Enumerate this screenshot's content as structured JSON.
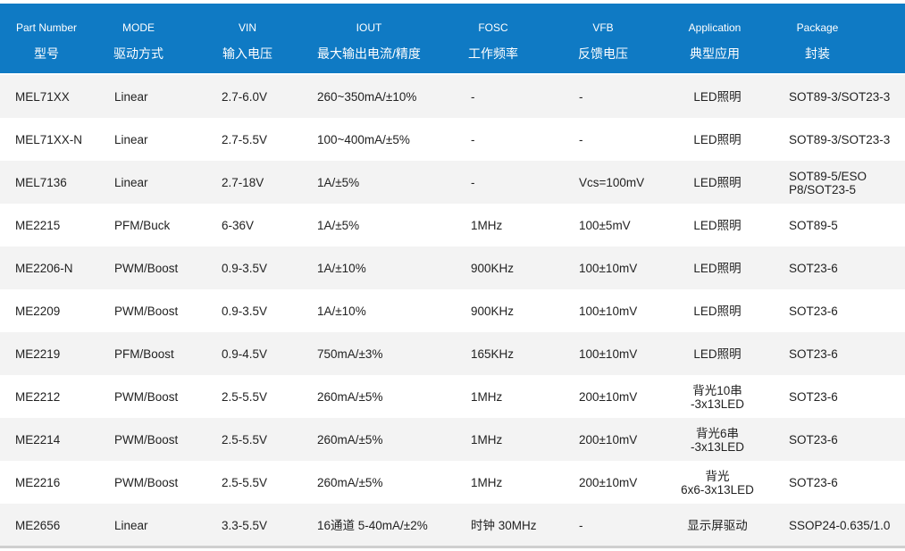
{
  "columns": [
    {
      "en": "Part Number",
      "cn": "型号"
    },
    {
      "en": "MODE",
      "cn": "驱动方式"
    },
    {
      "en": "VIN",
      "cn": "输入电压"
    },
    {
      "en": "IOUT",
      "cn": "最大输出电流/精度"
    },
    {
      "en": "FOSC",
      "cn": "工作频率"
    },
    {
      "en": "VFB",
      "cn": "反馈电压"
    },
    {
      "en": "Application",
      "cn": "典型应用"
    },
    {
      "en": "Package",
      "cn": "封装"
    }
  ],
  "rows": [
    [
      "MEL71XX",
      "Linear",
      "2.7-6.0V",
      "260~350mA/±10%",
      "-",
      "-",
      "LED照明",
      "SOT89-3/SOT23-3"
    ],
    [
      "MEL71XX-N",
      "Linear",
      "2.7-5.5V",
      "100~400mA/±5%",
      "-",
      "-",
      "LED照明",
      "SOT89-3/SOT23-3"
    ],
    [
      "MEL7136",
      "Linear",
      "2.7-18V",
      "1A/±5%",
      "-",
      "Vcs=100mV",
      "LED照明",
      "SOT89-5/ESO\nP8/SOT23-5"
    ],
    [
      "ME2215",
      "PFM/Buck",
      "6-36V",
      "1A/±5%",
      "1MHz",
      "100±5mV",
      "LED照明",
      "SOT89-5"
    ],
    [
      "ME2206-N",
      "PWM/Boost",
      "0.9-3.5V",
      "1A/±10%",
      "900KHz",
      "100±10mV",
      "LED照明",
      "SOT23-6"
    ],
    [
      "ME2209",
      "PWM/Boost",
      "0.9-3.5V",
      "1A/±10%",
      "900KHz",
      "100±10mV",
      "LED照明",
      "SOT23-6"
    ],
    [
      "ME2219",
      "PFM/Boost",
      "0.9-4.5V",
      "750mA/±3%",
      "165KHz",
      "100±10mV",
      "LED照明",
      "SOT23-6"
    ],
    [
      "ME2212",
      "PWM/Boost",
      "2.5-5.5V",
      "260mA/±5%",
      "1MHz",
      "200±10mV",
      "背光10串\n-3x13LED",
      "SOT23-6"
    ],
    [
      "ME2214",
      "PWM/Boost",
      "2.5-5.5V",
      "260mA/±5%",
      "1MHz",
      "200±10mV",
      "背光6串\n-3x13LED",
      "SOT23-6"
    ],
    [
      "ME2216",
      "PWM/Boost",
      "2.5-5.5V",
      "260mA/±5%",
      "1MHz",
      "200±10mV",
      "背光\n6x6-3x13LED",
      "SOT23-6"
    ],
    [
      "ME2656",
      "Linear",
      "3.3-5.5V",
      "16通道 5-40mA/±2%",
      "时钟 30MHz",
      "-",
      "显示屏驱动",
      "SSOP24-0.635/1.0"
    ]
  ]
}
